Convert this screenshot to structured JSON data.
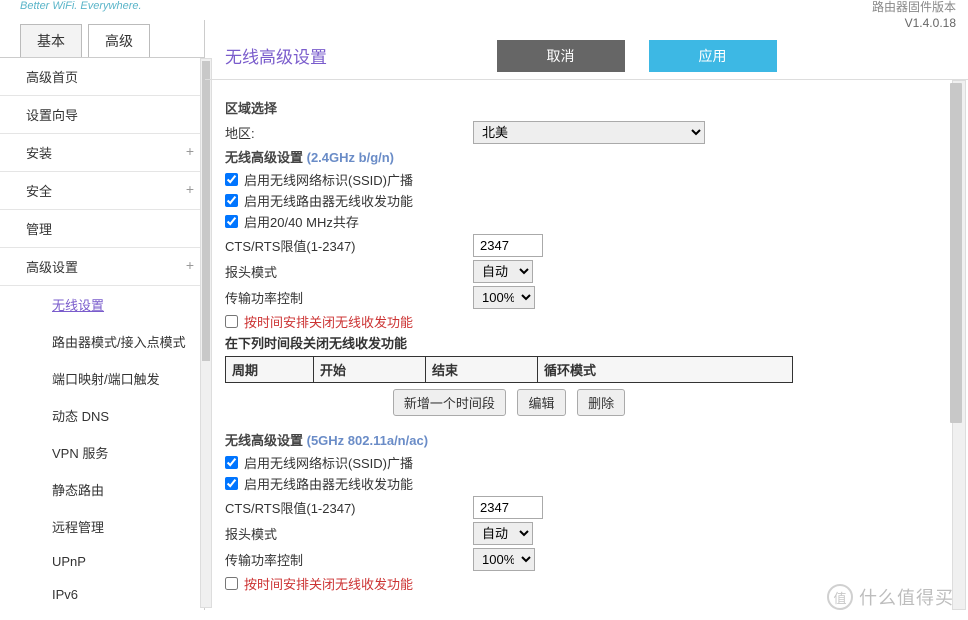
{
  "header": {
    "tagline": "Better WiFi. Everywhere.",
    "versionLabel": "路由器固件版本",
    "version": "V1.4.0.18"
  },
  "tabs": {
    "basic": "基本",
    "advanced": "高级"
  },
  "sidebar": {
    "items": [
      {
        "label": "高级首页"
      },
      {
        "label": "设置向导"
      },
      {
        "label": "安装",
        "expandable": true
      },
      {
        "label": "安全",
        "expandable": true
      },
      {
        "label": "管理"
      },
      {
        "label": "高级设置",
        "expandable": true
      }
    ],
    "subitems": [
      {
        "label": "无线设置",
        "selected": true
      },
      {
        "label": "路由器模式/接入点模式"
      },
      {
        "label": "端口映射/端口触发"
      },
      {
        "label": "动态 DNS"
      },
      {
        "label": "VPN 服务"
      },
      {
        "label": "静态路由"
      },
      {
        "label": "远程管理"
      },
      {
        "label": "UPnP"
      },
      {
        "label": "IPv6"
      }
    ]
  },
  "page": {
    "title": "无线高级设置",
    "cancel": "取消",
    "apply": "应用"
  },
  "regionSection": {
    "title": "区域选择",
    "label": "地区:",
    "value": "北美"
  },
  "band24": {
    "title": "无线高级设置 ",
    "band": "(2.4GHz b/g/n)",
    "cb1": "启用无线网络标识(SSID)广播",
    "cb2": "启用无线路由器无线收发功能",
    "cb3": "启用20/40 MHz共存",
    "ctsLabel": "CTS/RTS限值(1-2347)",
    "ctsValue": "2347",
    "preambleLabel": "报头模式",
    "preambleValue": "自动",
    "txPowerLabel": "传输功率控制",
    "txPowerValue": "100%",
    "schedCb": "按时间安排关闭无线收发功能",
    "schedNote": "在下列时间段关闭无线收发功能",
    "th1": "周期",
    "th2": "开始",
    "th3": "结束",
    "th4": "循环模式",
    "btnAdd": "新增一个时间段",
    "btnEdit": "编辑",
    "btnDel": "删除"
  },
  "band5": {
    "title": "无线高级设置 ",
    "band": "(5GHz 802.11a/n/ac)",
    "cb1": "启用无线网络标识(SSID)广播",
    "cb2": "启用无线路由器无线收发功能",
    "ctsLabel": "CTS/RTS限值(1-2347)",
    "ctsValue": "2347",
    "preambleLabel": "报头模式",
    "preambleValue": "自动",
    "txPowerLabel": "传输功率控制",
    "txPowerValue": "100%",
    "schedCb": "按时间安排关闭无线收发功能"
  },
  "watermark": {
    "icon": "值",
    "text": "什么值得买"
  }
}
